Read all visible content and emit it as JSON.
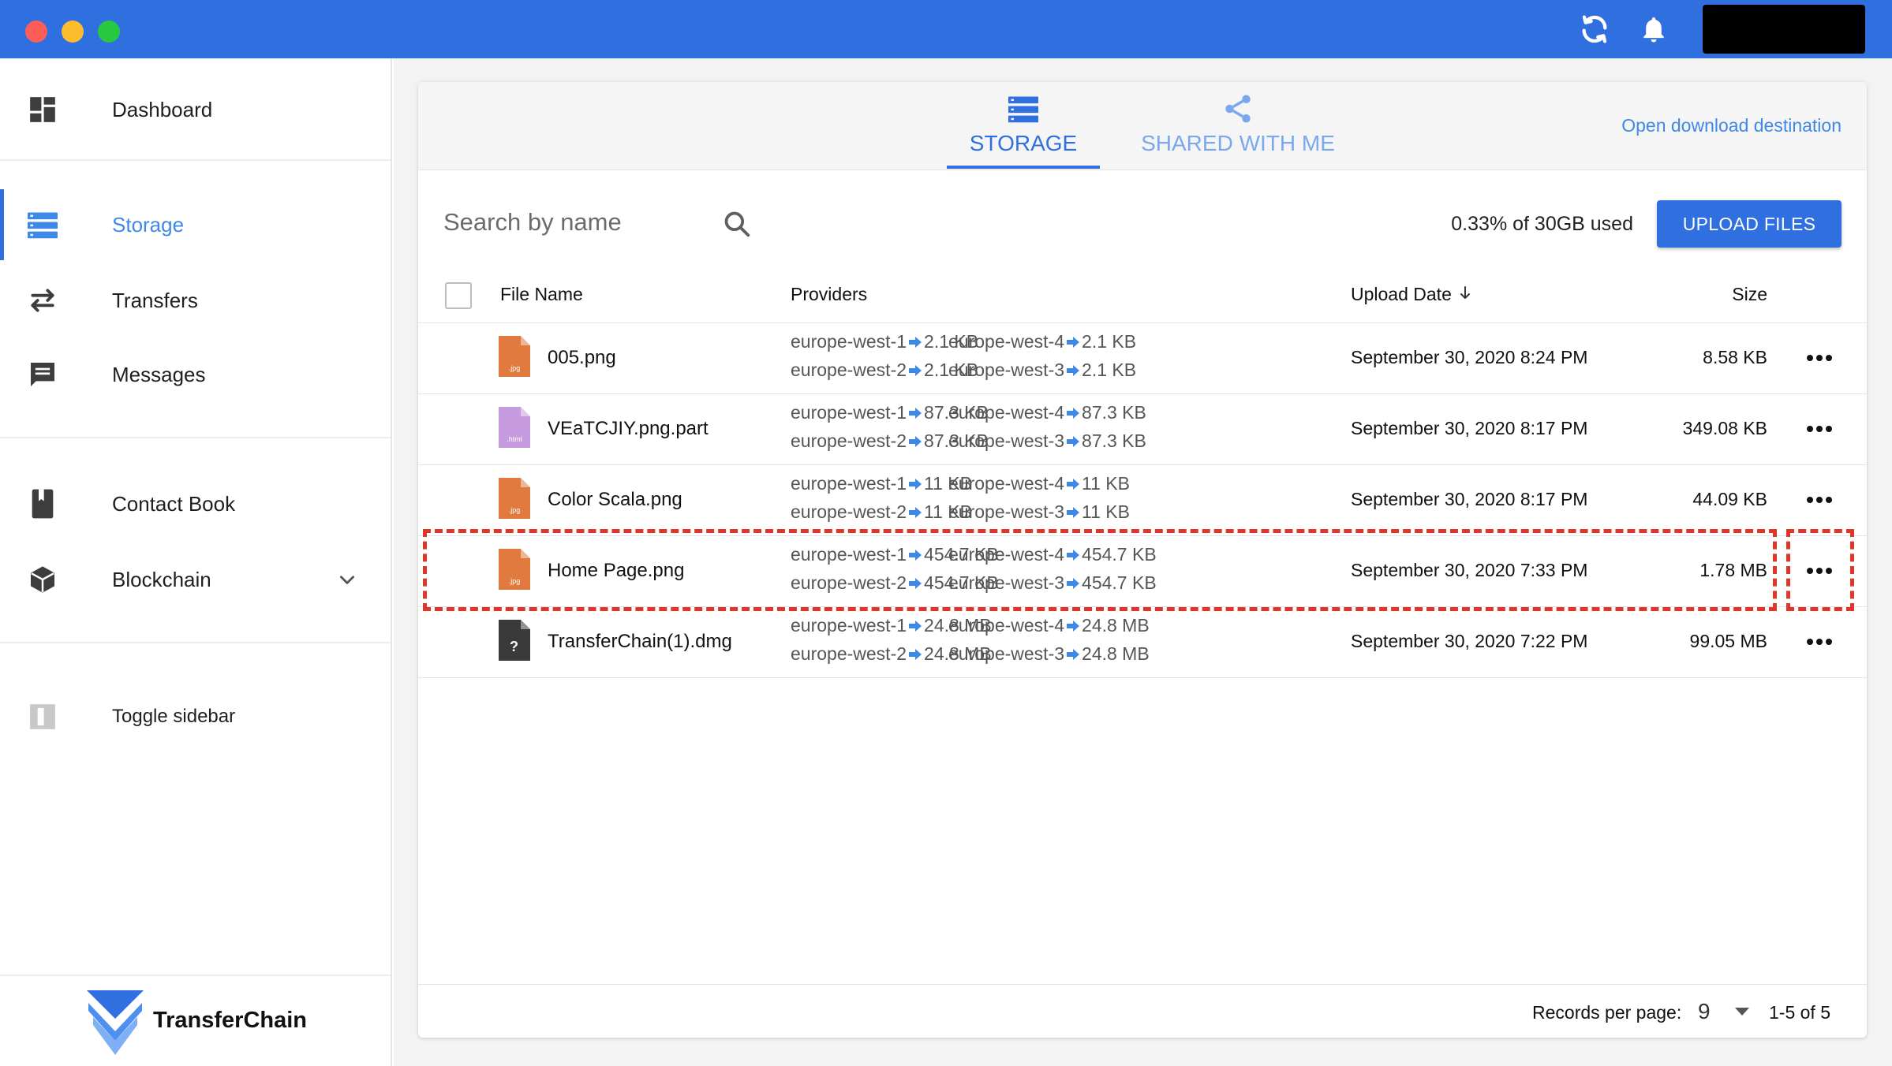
{
  "window": {
    "traffic_lights": [
      "close",
      "minimize",
      "zoom"
    ],
    "toolbar_icons": [
      "refresh-icon",
      "bell-icon"
    ],
    "accent_color": "#2f6fe0"
  },
  "sidebar": {
    "items": [
      {
        "label": "Dashboard",
        "icon": "dashboard-icon"
      },
      {
        "label": "Storage",
        "icon": "storage-icon",
        "active": true
      },
      {
        "label": "Transfers",
        "icon": "transfers-icon"
      },
      {
        "label": "Messages",
        "icon": "messages-icon"
      },
      {
        "label": "Contact Book",
        "icon": "contact-book-icon"
      },
      {
        "label": "Blockchain",
        "icon": "blockchain-icon",
        "expandable": true
      },
      {
        "label": "Toggle sidebar",
        "icon": "toggle-sidebar-icon"
      }
    ],
    "brand": "TransferChain"
  },
  "tabs": [
    {
      "label": "STORAGE",
      "icon": "storage-icon",
      "active": true
    },
    {
      "label": "SHARED WITH ME",
      "icon": "share-icon",
      "active": false
    }
  ],
  "header": {
    "open_destination": "Open download destination"
  },
  "toolbar": {
    "search_placeholder": "Search by name",
    "usage": "0.33% of 30GB used",
    "upload_label": "UPLOAD FILES"
  },
  "table": {
    "columns": {
      "file_name": "File Name",
      "providers": "Providers",
      "upload_date": "Upload Date",
      "size": "Size"
    },
    "rows": [
      {
        "name": "005.png",
        "icon_type": ".jpg",
        "icon_color": "#e07a3f",
        "providers": [
          {
            "name": "europe-west-1",
            "size": "2.1 KB"
          },
          {
            "name": "europe-west-4",
            "size": "2.1 KB"
          },
          {
            "name": "europe-west-2",
            "size": "2.1 KB"
          },
          {
            "name": "europe-west-3",
            "size": "2.1 KB"
          }
        ],
        "date": "September 30, 2020 8:24 PM",
        "size": "8.58 KB"
      },
      {
        "name": "VEaTCJIY.png.part",
        "icon_type": ".html",
        "icon_color": "#c79be0",
        "providers": [
          {
            "name": "europe-west-1",
            "size": "87.3 KB"
          },
          {
            "name": "europe-west-4",
            "size": "87.3 KB"
          },
          {
            "name": "europe-west-2",
            "size": "87.3 KB"
          },
          {
            "name": "europe-west-3",
            "size": "87.3 KB"
          }
        ],
        "date": "September 30, 2020 8:17 PM",
        "size": "349.08 KB"
      },
      {
        "name": "Color Scala.png",
        "icon_type": ".jpg",
        "icon_color": "#e07a3f",
        "providers": [
          {
            "name": "europe-west-1",
            "size": "11 KB"
          },
          {
            "name": "europe-west-4",
            "size": "11 KB"
          },
          {
            "name": "europe-west-2",
            "size": "11 KB"
          },
          {
            "name": "europe-west-3",
            "size": "11 KB"
          }
        ],
        "date": "September 30, 2020 8:17 PM",
        "size": "44.09 KB"
      },
      {
        "name": "Home Page.png",
        "icon_type": ".jpg",
        "icon_color": "#e07a3f",
        "providers": [
          {
            "name": "europe-west-1",
            "size": "454.7 KB"
          },
          {
            "name": "europe-west-4",
            "size": "454.7 KB"
          },
          {
            "name": "europe-west-2",
            "size": "454.7 KB"
          },
          {
            "name": "europe-west-3",
            "size": "454.7 KB"
          }
        ],
        "date": "September 30, 2020 7:33 PM",
        "size": "1.78 MB"
      },
      {
        "name": "TransferChain(1).dmg",
        "icon_type": "?",
        "icon_color": "#3a3a3a",
        "providers": [
          {
            "name": "europe-west-1",
            "size": "24.8 MB"
          },
          {
            "name": "europe-west-4",
            "size": "24.8 MB"
          },
          {
            "name": "europe-west-2",
            "size": "24.8 MB"
          },
          {
            "name": "europe-west-3",
            "size": "24.8 MB"
          }
        ],
        "date": "September 30, 2020 7:22 PM",
        "size": "99.05 MB"
      }
    ]
  },
  "pagination": {
    "records_label": "Records per page:",
    "records_value": "9",
    "range": "1-5 of 5"
  },
  "annotation_color": "#e0352b"
}
